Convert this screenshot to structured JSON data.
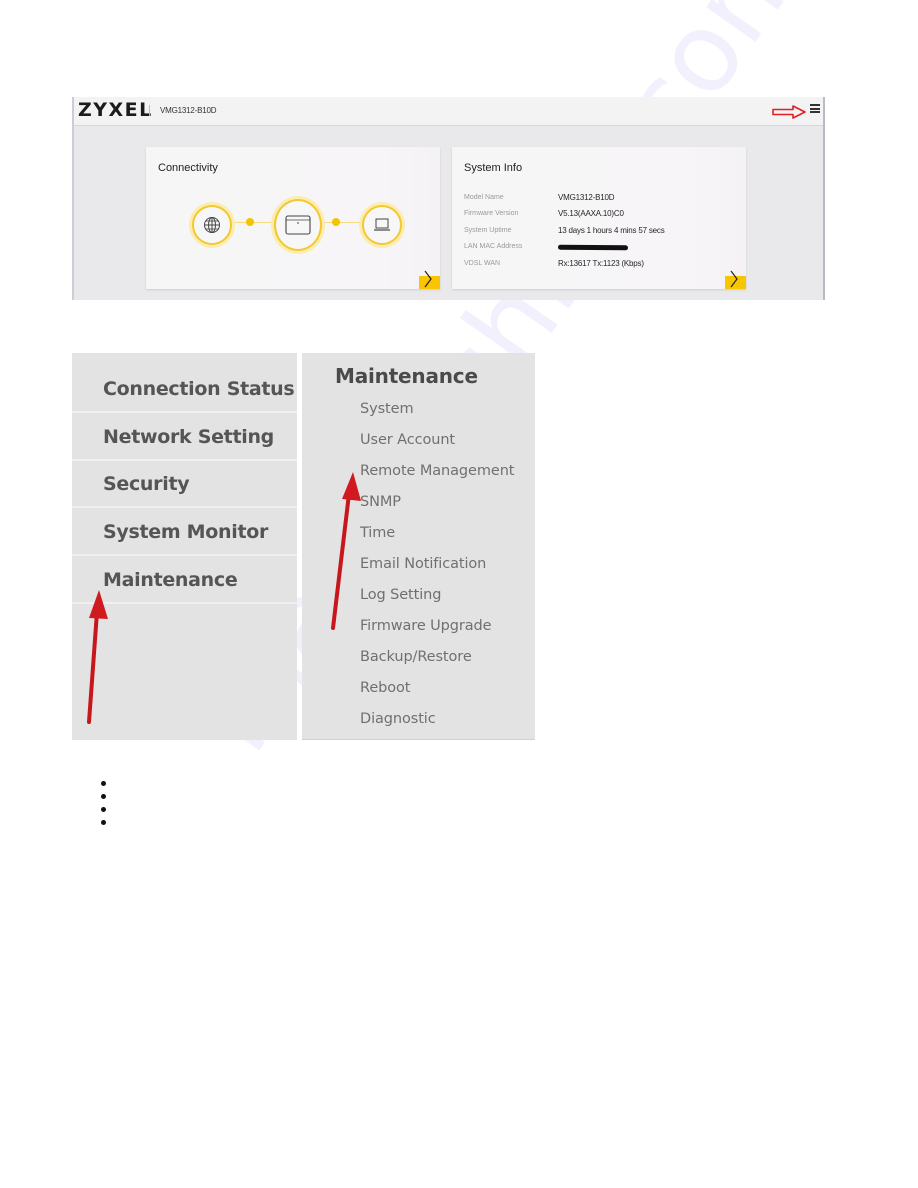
{
  "router_ui": {
    "brand": "ZYXEL",
    "model": "VMG1312-B10D",
    "menu_icon": "hamburger-menu-icon",
    "annotation_arrow_color": "#e02020",
    "accent_color": "#f7c600",
    "connectivity_card": {
      "title": "Connectivity",
      "nodes": [
        "globe-icon",
        "router-icon",
        "laptop-icon"
      ],
      "status": [
        "connected",
        "connected"
      ],
      "next_icon": "chevron-right-icon"
    },
    "system_info_card": {
      "title": "System Info",
      "rows": [
        {
          "label": "Model Name",
          "value": "VMG1312-B10D"
        },
        {
          "label": "Firmware Version",
          "value": "V5.13(AAXA.10)C0"
        },
        {
          "label": "System Uptime",
          "value": "13 days 1 hours 4 mins 57 secs"
        },
        {
          "label": "LAN MAC Address",
          "value": "[redacted]"
        },
        {
          "label": "VDSL WAN",
          "value": "Rx:13617 Tx:1123 (Kbps)"
        }
      ],
      "next_icon": "chevron-right-icon"
    }
  },
  "main_menu": {
    "items": [
      {
        "label": "Connection Status"
      },
      {
        "label": "Network Setting"
      },
      {
        "label": "Security"
      },
      {
        "label": "System Monitor"
      },
      {
        "label": "Maintenance"
      }
    ]
  },
  "maintenance_menu": {
    "title": "Maintenance",
    "items": [
      {
        "label": "System"
      },
      {
        "label": "User Account"
      },
      {
        "label": "Remote Management"
      },
      {
        "label": "SNMP"
      },
      {
        "label": "Time"
      },
      {
        "label": "Email Notification"
      },
      {
        "label": "Log Setting"
      },
      {
        "label": "Firmware Upgrade"
      },
      {
        "label": "Backup/Restore"
      },
      {
        "label": "Reboot"
      },
      {
        "label": "Diagnostic"
      }
    ]
  },
  "bullets": [
    "",
    "",
    "",
    ""
  ],
  "watermark": "manualshive.com"
}
